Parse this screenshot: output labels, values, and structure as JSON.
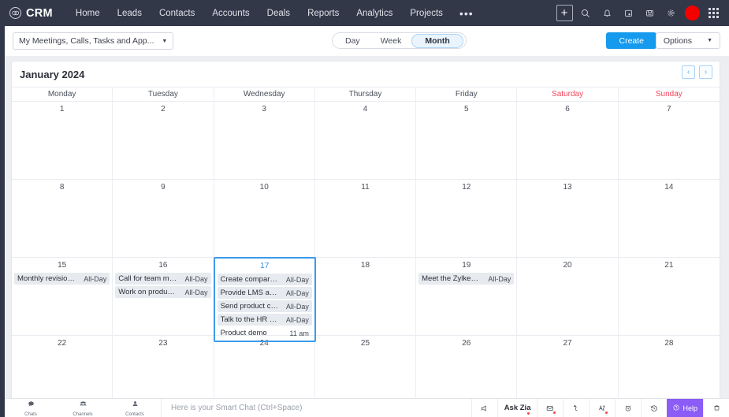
{
  "topnav": {
    "brand": "CRM",
    "brand_icon": "zoho-logo-icon",
    "links": [
      "Home",
      "Leads",
      "Contacts",
      "Accounts",
      "Deals",
      "Reports",
      "Analytics",
      "Projects"
    ],
    "more_label": "•••",
    "icons": [
      "plus-icon",
      "search-icon",
      "bell-icon",
      "notes-icon",
      "save-icon",
      "gear-icon",
      "avatar",
      "apps-grid-icon"
    ],
    "bg_color": "#323848",
    "avatar_color": "#f50000"
  },
  "toolbar": {
    "filter_value": "My Meetings, Calls, Tasks and App...",
    "views": [
      {
        "label": "Day",
        "active": false
      },
      {
        "label": "Week",
        "active": false
      },
      {
        "label": "Month",
        "active": true
      }
    ],
    "create_label": "Create",
    "options_label": "Options",
    "create_color": "#159aed"
  },
  "calendar": {
    "title": "January 2024",
    "prev_label": "‹",
    "next_label": "›",
    "day_headers": [
      {
        "label": "Monday",
        "weekend": false
      },
      {
        "label": "Tuesday",
        "weekend": false
      },
      {
        "label": "Wednesday",
        "weekend": false
      },
      {
        "label": "Thursday",
        "weekend": false
      },
      {
        "label": "Friday",
        "weekend": false
      },
      {
        "label": "Saturday",
        "weekend": true
      },
      {
        "label": "Sunday",
        "weekend": true
      }
    ],
    "weekend_color": "#f4465b",
    "selected_color": "#3d9bea",
    "weeks": [
      {
        "days": [
          {
            "num": "1",
            "events": []
          },
          {
            "num": "2",
            "events": []
          },
          {
            "num": "3",
            "events": []
          },
          {
            "num": "4",
            "events": []
          },
          {
            "num": "5",
            "events": []
          },
          {
            "num": "6",
            "events": []
          },
          {
            "num": "7",
            "events": []
          }
        ]
      },
      {
        "days": [
          {
            "num": "8",
            "events": []
          },
          {
            "num": "9",
            "events": []
          },
          {
            "num": "10",
            "events": []
          },
          {
            "num": "11",
            "events": []
          },
          {
            "num": "12",
            "events": []
          },
          {
            "num": "13",
            "events": []
          },
          {
            "num": "14",
            "events": []
          }
        ]
      },
      {
        "days": [
          {
            "num": "15",
            "selected": false,
            "events": [
              {
                "title": "Monthly revision of...",
                "time": "All-Day",
                "chip": true
              }
            ]
          },
          {
            "num": "16",
            "selected": false,
            "events": [
              {
                "title": "Call for team meeti...",
                "time": "All-Day",
                "chip": true
              },
              {
                "title": "Work on product c...",
                "time": "All-Day",
                "chip": true
              }
            ]
          },
          {
            "num": "17",
            "selected": true,
            "events": [
              {
                "title": "Create compariso...",
                "time": "All-Day",
                "chip": true
              },
              {
                "title": "Provide LMS access",
                "time": "All-Day",
                "chip": true
              },
              {
                "title": "Send product com...",
                "time": "All-Day",
                "chip": true
              },
              {
                "title": "Talk to the HR team",
                "time": "All-Day",
                "chip": true
              },
              {
                "title": "Product demo",
                "time": "11 am",
                "chip": false
              }
            ]
          },
          {
            "num": "18",
            "selected": false,
            "events": []
          },
          {
            "num": "19",
            "selected": false,
            "events": [
              {
                "title": "Meet the Zylker clie...",
                "time": "All-Day",
                "chip": true
              }
            ]
          },
          {
            "num": "20",
            "selected": false,
            "events": []
          },
          {
            "num": "21",
            "selected": false,
            "events": []
          }
        ]
      },
      {
        "days": [
          {
            "num": "22",
            "events": []
          },
          {
            "num": "23",
            "events": []
          },
          {
            "num": "24",
            "events": []
          },
          {
            "num": "25",
            "events": []
          },
          {
            "num": "26",
            "events": []
          },
          {
            "num": "27",
            "events": []
          },
          {
            "num": "28",
            "events": []
          }
        ]
      }
    ]
  },
  "bottombar": {
    "items": [
      {
        "label": "Chats",
        "icon": "chat-bubble-icon"
      },
      {
        "label": "Channels",
        "icon": "channels-icon"
      },
      {
        "label": "Contacts",
        "icon": "contacts-person-icon"
      }
    ],
    "chat_placeholder": "Here is your Smart Chat (Ctrl+Space)",
    "askzia_label": "Ask Zia",
    "help_label": "Help",
    "help_color": "#8b5cf6",
    "right_icons": [
      "megaphone-icon",
      "email-icon",
      "calls-icon",
      "zia-voice-icon",
      "alarm-icon",
      "recent-history-icon",
      "trash-icon"
    ]
  }
}
